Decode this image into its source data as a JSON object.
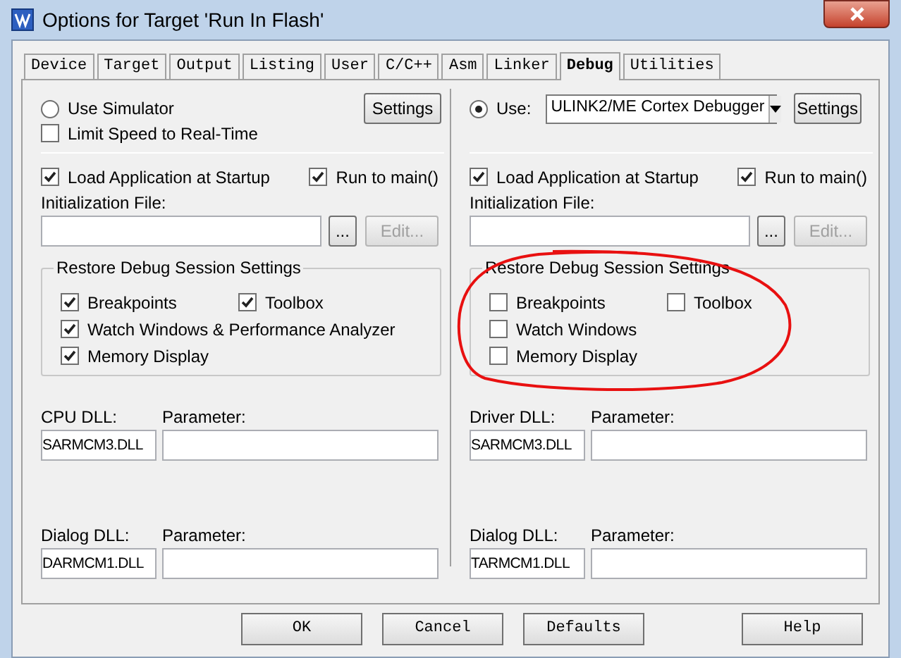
{
  "window": {
    "title": "Options for Target 'Run In Flash'"
  },
  "tabs": [
    {
      "label": "Device",
      "selected": false
    },
    {
      "label": "Target",
      "selected": false
    },
    {
      "label": "Output",
      "selected": false
    },
    {
      "label": "Listing",
      "selected": false
    },
    {
      "label": "User",
      "selected": false
    },
    {
      "label": "C/C++",
      "selected": false
    },
    {
      "label": "Asm",
      "selected": false
    },
    {
      "label": "Linker",
      "selected": false
    },
    {
      "label": "Debug",
      "selected": true
    },
    {
      "label": "Utilities",
      "selected": false
    }
  ],
  "columns": [
    {
      "use": {
        "label": "Use Simulator",
        "selected": false
      },
      "settings_button": "Settings",
      "limit_speed": {
        "label": "Limit Speed to Real-Time",
        "checked": false
      },
      "load_app": {
        "label": "Load Application at Startup",
        "checked": true
      },
      "run_to_main": {
        "label": "Run to main()",
        "checked": true
      },
      "init_file": {
        "label": "Initialization File:",
        "browse": "...",
        "edit": {
          "label": "Edit...",
          "disabled": true
        }
      },
      "restore": {
        "title": "Restore Debug Session Settings",
        "items": [
          {
            "label": "Breakpoints",
            "checked": true
          },
          {
            "label": "Toolbox",
            "checked": true
          },
          {
            "label": "Watch Windows & Performance Analyzer",
            "checked": true
          },
          {
            "label": "Memory Display",
            "checked": true
          }
        ]
      },
      "dll": {
        "label": "CPU DLL:",
        "value": "SARMCM3.DLL",
        "param_label": "Parameter:"
      },
      "dialog_dll": {
        "label": "Dialog DLL:",
        "value": "DARMCM1.DLL",
        "param_label": "Parameter:"
      }
    },
    {
      "use": {
        "label": "Use:",
        "selected": true,
        "driver": "ULINK2/ME Cortex Debugger"
      },
      "settings_button": "Settings",
      "load_app": {
        "label": "Load Application at Startup",
        "checked": true
      },
      "run_to_main": {
        "label": "Run to main()",
        "checked": true
      },
      "init_file": {
        "label": "Initialization File:",
        "browse": "...",
        "edit": {
          "label": "Edit...",
          "disabled": true
        }
      },
      "restore": {
        "title": "Restore Debug Session Settings",
        "items": [
          {
            "label": "Breakpoints",
            "checked": false
          },
          {
            "label": "Toolbox",
            "checked": false
          },
          {
            "label": "Watch Windows",
            "checked": false
          },
          {
            "label": "Memory Display",
            "checked": false
          }
        ]
      },
      "dll": {
        "label": "Driver DLL:",
        "value": "SARMCM3.DLL",
        "param_label": "Parameter:"
      },
      "dialog_dll": {
        "label": "Dialog DLL:",
        "value": "TARMCM1.DLL",
        "param_label": "Parameter:"
      }
    }
  ],
  "buttons": [
    {
      "label": "OK"
    },
    {
      "label": "Cancel"
    },
    {
      "label": "Defaults"
    },
    {
      "label": "Help"
    }
  ]
}
